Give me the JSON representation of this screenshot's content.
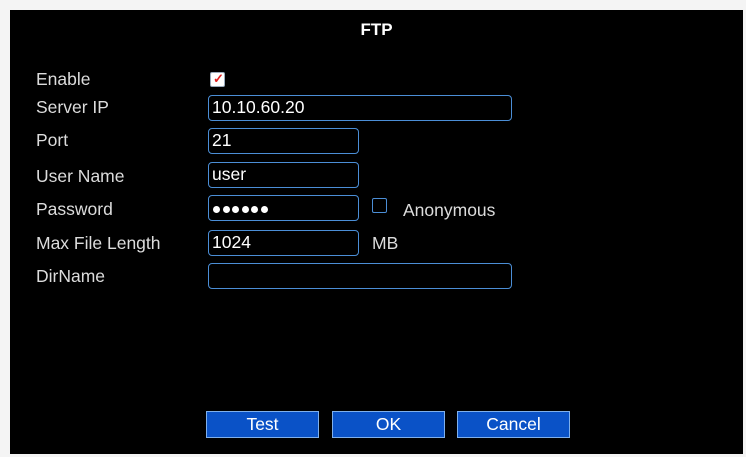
{
  "dialog": {
    "title": "FTP"
  },
  "form": {
    "enable": {
      "label": "Enable",
      "checked": true
    },
    "server_ip": {
      "label": "Server IP",
      "value": "10.10.60.20"
    },
    "port": {
      "label": "Port",
      "value": "21"
    },
    "user_name": {
      "label": "User Name",
      "value": "user"
    },
    "password": {
      "label": "Password",
      "masked_length": 6
    },
    "anonymous": {
      "label": "Anonymous",
      "checked": false
    },
    "max_file_length": {
      "label": "Max File Length",
      "value": "1024",
      "unit": "MB"
    },
    "dir_name": {
      "label": "DirName",
      "value": ""
    }
  },
  "buttons": {
    "test": "Test",
    "ok": "OK",
    "cancel": "Cancel"
  },
  "colors": {
    "background": "#000000",
    "field_border": "#4b8ed6",
    "button_fill": "#0a52c7",
    "check_mark": "#e02020"
  },
  "icons": {
    "enable_checkbox": "checkbox-checked-icon",
    "anonymous_checkbox": "checkbox-unchecked-icon"
  }
}
